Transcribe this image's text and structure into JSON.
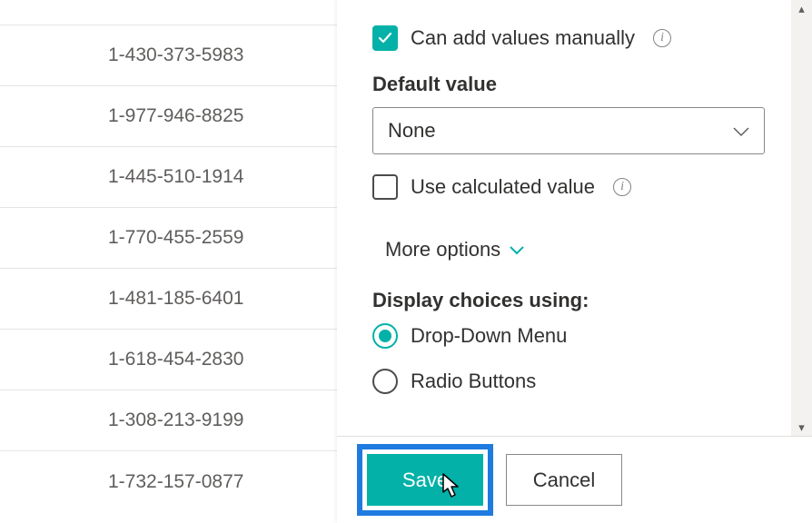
{
  "list": {
    "rows": [
      "",
      "1-430-373-5983",
      "1-977-946-8825",
      "1-445-510-1914",
      "1-770-455-2559",
      "1-481-185-6401",
      "1-618-454-2830",
      "1-308-213-9199",
      "1-732-157-0877"
    ]
  },
  "panel": {
    "can_add_label": "Can add values manually",
    "default_value_label": "Default value",
    "default_value_selected": "None",
    "use_calculated_label": "Use calculated value",
    "more_options_label": "More options",
    "display_choices_label": "Display choices using:",
    "choice_dropdown": "Drop-Down Menu",
    "choice_radio": "Radio Buttons"
  },
  "footer": {
    "save_label": "Save",
    "cancel_label": "Cancel"
  },
  "colors": {
    "accent": "#03b1a8",
    "highlight": "#1f7be0"
  }
}
